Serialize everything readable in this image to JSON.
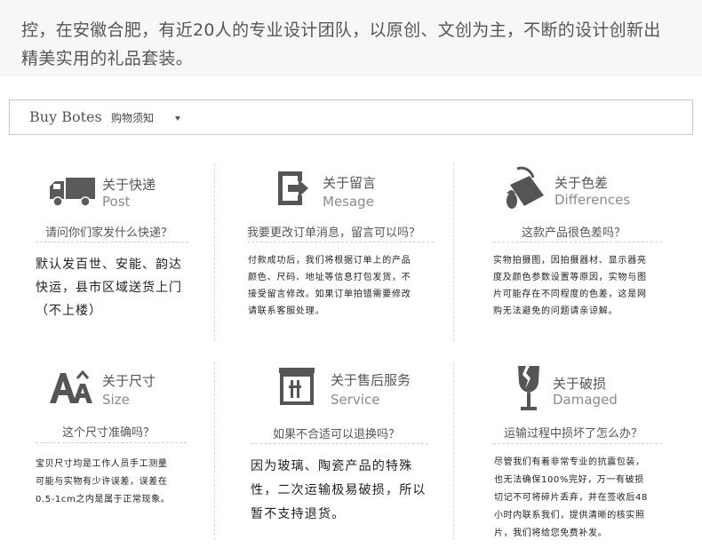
{
  "intro": {
    "line1": "",
    "line2": "控，在安徽合肥，有近20人的专业设计团队，以原创、文创为主，不断的设计创新出",
    "line3": "精美实用的礼品套装。"
  },
  "bar": {
    "title_en": "Buy Botes",
    "title_cn": "购物须知"
  },
  "items": [
    {
      "icon": "truck-icon",
      "title_cn": "关于快递",
      "title_en": "Post",
      "question": "请问你们家发什么快递？",
      "body": [
        "默认发百世、安能、韵达",
        "快运，县市区域送货上门",
        "（不上楼）"
      ]
    },
    {
      "icon": "message-icon",
      "title_cn": "关于留言",
      "title_en": "Mesage",
      "question": "我要更改订单消息，留言可以吗？",
      "body": [
        "付款成功后，我们将根据订单上的产品",
        "颜色、尺码、地址等信息打包发货，不",
        "接受留言修改。如果订单拍错需要修改",
        "请联系客服处理。"
      ]
    },
    {
      "icon": "paint-bucket-icon",
      "title_cn": "关于色差",
      "title_en": "Differences",
      "question": "这款产品很色差吗？",
      "body": [
        "实物拍摄图，因拍摄器材、显示器亮",
        "度及颜色参数设置等原因，实物与图",
        "片可能存在不同程度的色差，这是网",
        "购无法避免的问题请亲谅解。"
      ]
    },
    {
      "icon": "size-aa-icon",
      "title_cn": "关于尺寸",
      "title_en": "Size",
      "question": "这个尺寸准确吗？",
      "body": [
        "宝贝尺寸均是工作人员手工测量",
        "可能与实物有少许误差，误差在",
        "0.5-1cm之内是属于正常现象。"
      ]
    },
    {
      "icon": "service-box-icon",
      "title_cn": "关于售后服务",
      "title_en": "Service",
      "question": "如果不合适可以退换吗？",
      "body": [
        "因为玻璃、陶瓷产品的特殊",
        "性，二次运输极易破损，所以",
        "暂不支持退货。"
      ]
    },
    {
      "icon": "broken-glass-icon",
      "title_cn": "关于破损",
      "title_en": "Damaged",
      "question": "运输过程中损坏了怎么办？",
      "body": [
        "尽管我们有着非常专业的抗震包装，",
        "也无法确保100%完好，万一有破损",
        "切记不可将碎片丢弃，并在签收后48",
        "小时内联系我们，提供清晰的核实照",
        "片，我们将给您免费补发。"
      ]
    }
  ]
}
